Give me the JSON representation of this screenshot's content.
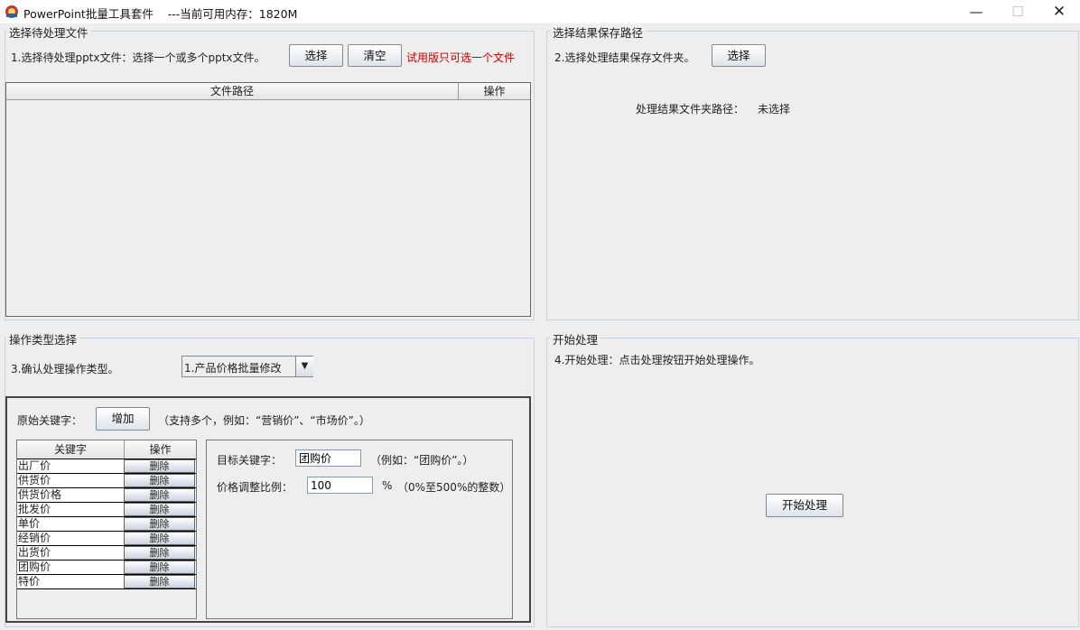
{
  "window": {
    "title": "PowerPoint批量工具套件    ---当前可用内存：1820M",
    "minimize_glyph": "—",
    "maximize_glyph": "☐",
    "close_glyph": "✕",
    "icon": "powerpoint-app-icon"
  },
  "select_files": {
    "group_title": "选择待处理文件",
    "step_label": "1.选择待处理pptx文件：选择一个或多个pptx文件。",
    "select_button": "选择",
    "clear_button": "清空",
    "trial_notice": "试用版只可选一个文件",
    "trial_color": "#cc0000",
    "columns": [
      "文件路径",
      "操作"
    ]
  },
  "save_path": {
    "group_title": "选择结果保存路径",
    "step_label": "2.选择处理结果保存文件夹。",
    "select_button": "选择",
    "folder_label": "处理结果文件夹路径：",
    "folder_value": "未选择"
  },
  "operation": {
    "group_title": "操作类型选择",
    "step_label": "3.确认处理操作类型。",
    "selected_operation": "1.产品价格批量修改",
    "dropdown_glyph": "▼",
    "original_keyword_label": "原始关键字：",
    "add_button": "增加",
    "keyword_hint": "（支持多个，例如：“营销价”、“市场价”。）",
    "keyword_columns": [
      "关键字",
      "操作"
    ],
    "keywords": [
      "出厂价",
      "供货价",
      "供货价格",
      "批发价",
      "单价",
      "经销价",
      "出货价",
      "团购价",
      "特价"
    ],
    "delete_label": "删除",
    "target_keyword_label": "目标关键字：",
    "target_keyword_value": "团购价",
    "target_keyword_hint": "（例如：“团购价”。）",
    "ratio_label": "价格调整比例：",
    "ratio_value": "100",
    "ratio_unit": "%",
    "ratio_hint": "（0%至500%的整数）"
  },
  "start": {
    "group_title": "开始处理",
    "step_label": "4.开始处理：点击处理按钮开始处理操作。",
    "start_button": "开始处理"
  }
}
